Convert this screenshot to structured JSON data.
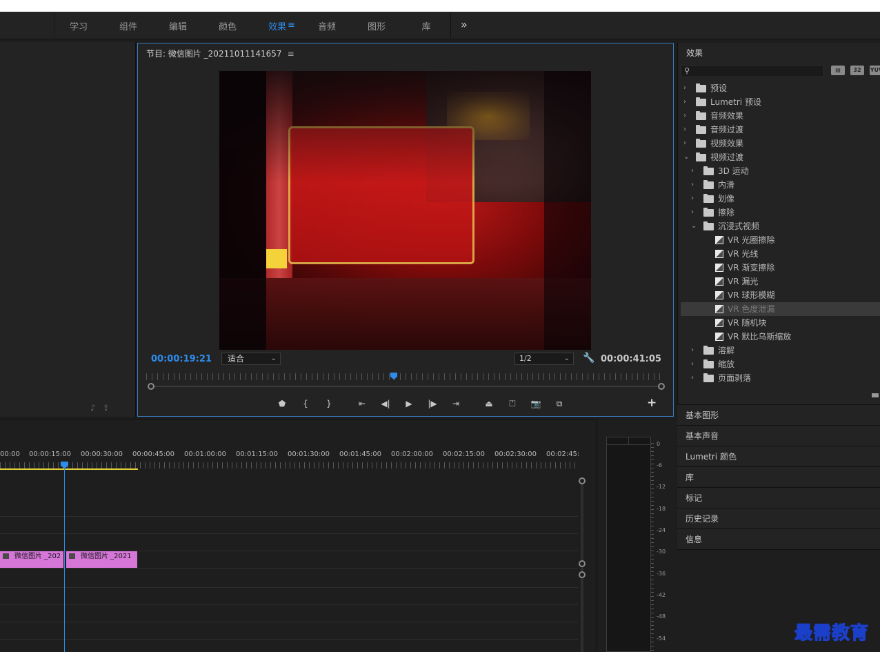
{
  "workspace": {
    "tabs": [
      "学习",
      "组件",
      "编辑",
      "颜色",
      "效果",
      "音频",
      "图形",
      "库"
    ],
    "active_tab": "效果",
    "more": "»"
  },
  "program": {
    "title": "节目: 微信图片 _20211011141657",
    "menu": "≡",
    "timecode_current": "00:00:19:21",
    "fit_label": "适合",
    "resolution": "1/2",
    "timecode_duration": "00:00:41:05"
  },
  "timeline": {
    "ruler_labels": [
      "00:00",
      "00:00:15:00",
      "00:00:30:00",
      "00:00:45:00",
      "00:01:00:00",
      "00:01:15:00",
      "00:01:30:00",
      "00:01:45:00",
      "00:02:00:00",
      "00:02:15:00",
      "00:02:30:00",
      "00:02:45:"
    ],
    "clips": [
      "微信图片 _202",
      "微信图片 _2021"
    ]
  },
  "meter": {
    "scale": [
      "0",
      "-6",
      "-12",
      "-18",
      "-24",
      "-30",
      "-36",
      "-42",
      "-48",
      "-54"
    ]
  },
  "effects": {
    "title": "效果",
    "search_placeholder": "",
    "filter_buttons": [
      "▤",
      "32",
      "YUV"
    ],
    "tree": [
      {
        "label": "预设",
        "depth": 0,
        "kind": "preset-folder",
        "expanded": false
      },
      {
        "label": "Lumetri 预设",
        "depth": 0,
        "kind": "preset-folder",
        "expanded": false
      },
      {
        "label": "音频效果",
        "depth": 0,
        "kind": "folder",
        "expanded": false
      },
      {
        "label": "音频过渡",
        "depth": 0,
        "kind": "folder",
        "expanded": false
      },
      {
        "label": "视频效果",
        "depth": 0,
        "kind": "folder",
        "expanded": false
      },
      {
        "label": "视频过渡",
        "depth": 0,
        "kind": "folder",
        "expanded": true
      },
      {
        "label": "3D 运动",
        "depth": 1,
        "kind": "folder",
        "expanded": false
      },
      {
        "label": "内滑",
        "depth": 1,
        "kind": "folder",
        "expanded": false
      },
      {
        "label": "划像",
        "depth": 1,
        "kind": "folder",
        "expanded": false
      },
      {
        "label": "擦除",
        "depth": 1,
        "kind": "folder",
        "expanded": false
      },
      {
        "label": "沉浸式视频",
        "depth": 1,
        "kind": "folder",
        "expanded": true
      },
      {
        "label": "VR 光圈擦除",
        "depth": 2,
        "kind": "effect"
      },
      {
        "label": "VR 光线",
        "depth": 2,
        "kind": "effect"
      },
      {
        "label": "VR 渐变擦除",
        "depth": 2,
        "kind": "effect"
      },
      {
        "label": "VR 漏光",
        "depth": 2,
        "kind": "effect"
      },
      {
        "label": "VR 球形模糊",
        "depth": 2,
        "kind": "effect"
      },
      {
        "label": "VR 色度泄漏",
        "depth": 2,
        "kind": "effect",
        "selected": true
      },
      {
        "label": "VR 随机块",
        "depth": 2,
        "kind": "effect"
      },
      {
        "label": "VR 默比乌斯缩放",
        "depth": 2,
        "kind": "effect"
      },
      {
        "label": "溶解",
        "depth": 1,
        "kind": "folder",
        "expanded": false
      },
      {
        "label": "缩放",
        "depth": 1,
        "kind": "folder",
        "expanded": false
      },
      {
        "label": "页面剥落",
        "depth": 1,
        "kind": "folder",
        "expanded": false
      }
    ]
  },
  "panels": [
    "基本图形",
    "基本声音",
    "Lumetri 颜色",
    "库",
    "标记",
    "历史记录",
    "信息"
  ],
  "watermark": "最需教育",
  "colors": {
    "accent": "#2d8ceb",
    "clip": "#d576d8",
    "work_area": "#e2d23a",
    "panel_bg": "#232323"
  }
}
